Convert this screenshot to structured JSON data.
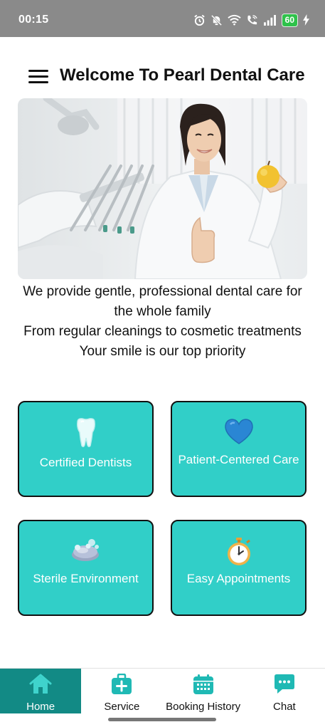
{
  "status_bar": {
    "time": "00:15",
    "battery_level": "60",
    "icons": [
      "alarm-icon",
      "mute-icon",
      "wifi-icon",
      "wifi-call-icon",
      "signal-icon",
      "battery-icon",
      "charging-icon"
    ]
  },
  "header": {
    "title": "Welcome To Pearl Dental Care",
    "menu_icon": "menu-icon"
  },
  "hero": {
    "image": "dentist-holding-apple-photo"
  },
  "intro": {
    "line1": "We provide gentle, professional dental care for the whole family",
    "line2": "From regular cleanings to cosmetic treatments",
    "line3": "Your smile is our top priority"
  },
  "features": [
    {
      "label": "Certified Dentists",
      "icon": "tooth-icon"
    },
    {
      "label": "Patient-Centered Care",
      "icon": "heart-icon"
    },
    {
      "label": "Sterile Environment",
      "icon": "soap-icon"
    },
    {
      "label": "Easy Appointments",
      "icon": "stopwatch-icon"
    }
  ],
  "bottom_nav": {
    "items": [
      {
        "label": "Home",
        "icon": "home-icon",
        "active": true
      },
      {
        "label": "Service",
        "icon": "medical-kit-icon",
        "active": false
      },
      {
        "label": "Booking History",
        "icon": "calendar-icon",
        "active": false
      },
      {
        "label": "Chat",
        "icon": "chat-icon",
        "active": false
      }
    ]
  },
  "colors": {
    "accent": "#31cfc8",
    "nav_active": "#128a85",
    "icon_teal": "#1fb9b4",
    "status_bar": "#8a8a8a"
  }
}
